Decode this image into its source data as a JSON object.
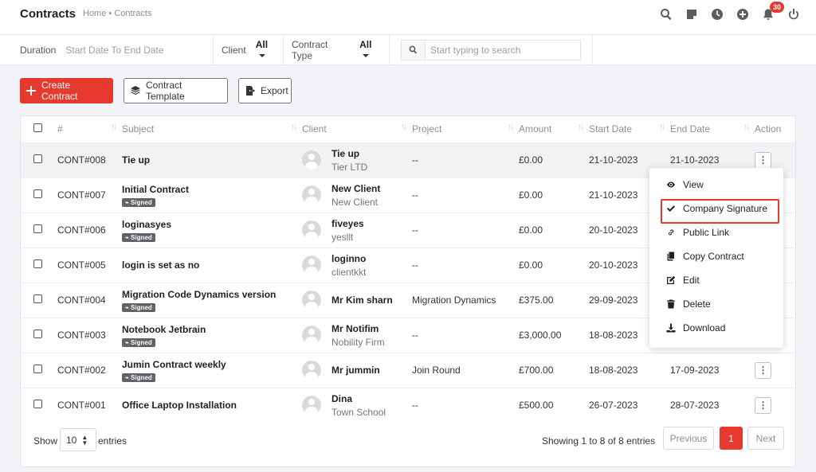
{
  "header": {
    "title": "Contracts",
    "breadcrumb": "Home • Contracts",
    "notification_count": "30",
    "icons": [
      "search-icon",
      "sticky-note-icon",
      "clock-icon",
      "plus-circle-icon",
      "bell-icon",
      "power-icon"
    ]
  },
  "filters": {
    "duration_label": "Duration",
    "duration_value": "Start Date To End Date",
    "client_label": "Client",
    "client_value": "All",
    "type_label": "Contract Type",
    "type_value": "All",
    "search_placeholder": "Start typing to search"
  },
  "toolbar": {
    "create_label": "Create Contract",
    "template_label": "Contract Template",
    "export_label": "Export"
  },
  "table": {
    "columns": [
      "#",
      "Subject",
      "Client",
      "Project",
      "Amount",
      "Start Date",
      "End Date",
      "Action"
    ],
    "signed_label": "Signed",
    "rows": [
      {
        "id": "CONT#008",
        "subject": "Tie up",
        "signed": false,
        "client_name": "Tie up",
        "client_company": "Tier LTD",
        "project": "--",
        "amount": "£0.00",
        "start": "21-10-2023",
        "end": "21-10-2023"
      },
      {
        "id": "CONT#007",
        "subject": "Initial Contract",
        "signed": true,
        "client_name": "New Client",
        "client_company": "New Client",
        "project": "--",
        "amount": "£0.00",
        "start": "21-10-2023",
        "end": ""
      },
      {
        "id": "CONT#006",
        "subject": "loginasyes",
        "signed": true,
        "client_name": "fiveyes",
        "client_company": "yesllt",
        "project": "--",
        "amount": "£0.00",
        "start": "20-10-2023",
        "end": ""
      },
      {
        "id": "CONT#005",
        "subject": "login is set as no",
        "signed": false,
        "client_name": "loginno",
        "client_company": "clientkkt",
        "project": "--",
        "amount": "£0.00",
        "start": "20-10-2023",
        "end": ""
      },
      {
        "id": "CONT#004",
        "subject": "Migration Code Dynamics version",
        "signed": true,
        "client_name": "Mr Kim sharn",
        "client_company": "",
        "project": "Migration Dynamics",
        "amount": "£375.00",
        "start": "29-09-2023",
        "end": ""
      },
      {
        "id": "CONT#003",
        "subject": "Notebook Jetbrain",
        "signed": true,
        "client_name": "Mr Notifim",
        "client_company": "Nobility Firm",
        "project": "--",
        "amount": "£3,000.00",
        "start": "18-08-2023",
        "end": ""
      },
      {
        "id": "CONT#002",
        "subject": "Jumin Contract weekly",
        "signed": true,
        "client_name": "Mr jummin",
        "client_company": "",
        "project": "Join Round",
        "amount": "£700.00",
        "start": "18-08-2023",
        "end": "17-09-2023"
      },
      {
        "id": "CONT#001",
        "subject": "Office Laptop Installation",
        "signed": false,
        "client_name": "Dina",
        "client_company": "Town School",
        "project": "--",
        "amount": "£500.00",
        "start": "26-07-2023",
        "end": "28-07-2023"
      }
    ]
  },
  "footer": {
    "show_label": "Show",
    "entries_value": "10",
    "entries_label": "entries",
    "showing_text": "Showing 1 to 8 of 8 entries",
    "prev_label": "Previous",
    "page": "1",
    "next_label": "Next"
  },
  "action_menu": {
    "items": [
      {
        "label": "View",
        "icon": "eye-icon"
      },
      {
        "label": "Company Signature",
        "icon": "check-icon"
      },
      {
        "label": "Public Link",
        "icon": "link-icon"
      },
      {
        "label": "Copy Contract",
        "icon": "copy-icon"
      },
      {
        "label": "Edit",
        "icon": "edit-icon"
      },
      {
        "label": "Delete",
        "icon": "trash-icon"
      },
      {
        "label": "Download",
        "icon": "download-icon"
      }
    ]
  },
  "colors": {
    "accent": "#e8392f",
    "signed_badge": "#5f6368"
  }
}
